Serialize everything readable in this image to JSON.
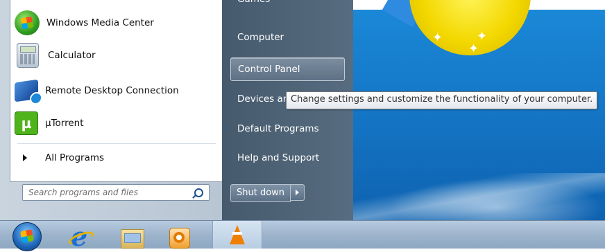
{
  "start_menu": {
    "programs": [
      {
        "label": "Windows Media Center",
        "icon": "windows-media-center-icon"
      },
      {
        "label": "Calculator",
        "icon": "calculator-icon"
      },
      {
        "label": "Remote Desktop Connection",
        "icon": "remote-desktop-icon"
      },
      {
        "label": "µTorrent",
        "icon": "utorrent-icon"
      }
    ],
    "all_programs_label": "All Programs",
    "search": {
      "placeholder": "Search programs and files"
    },
    "right_items": [
      {
        "label": "Games"
      },
      {
        "label": "Computer"
      },
      {
        "label": "Control Panel"
      },
      {
        "label": "Devices and Printers"
      },
      {
        "label": "Default Programs"
      },
      {
        "label": "Help and Support"
      }
    ],
    "shutdown_label": "Shut down"
  },
  "tooltip": {
    "text": "Change settings and customize the functionality of your computer."
  },
  "taskbar": {
    "icons": [
      "start-orb-icon",
      "internet-explorer-icon",
      "windows-explorer-icon",
      "media-player-icon",
      "vlc-icon"
    ]
  },
  "colors": {
    "right_pane": "#4f6478",
    "taskbar": "#a6bcd3",
    "desktop": "#1578c8"
  }
}
